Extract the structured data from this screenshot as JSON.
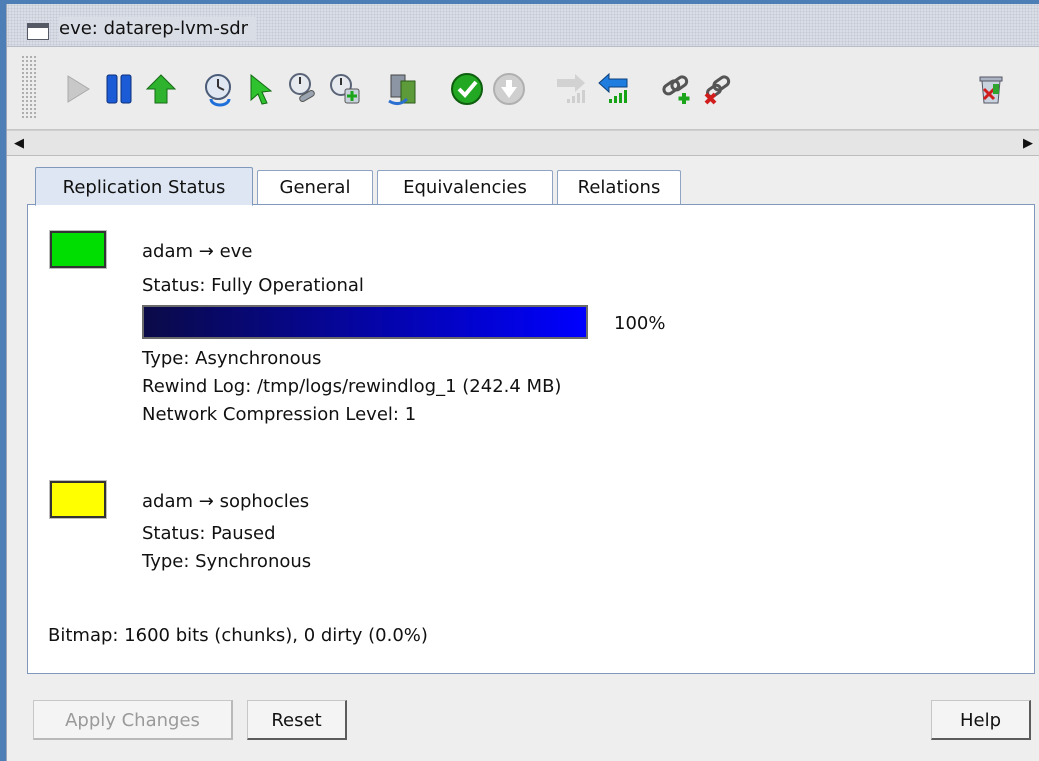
{
  "window": {
    "title": "eve: datarep-lvm-sdr"
  },
  "toolbar": {
    "buttons": [
      {
        "icon": "play-icon",
        "enabled": false
      },
      {
        "icon": "pause-icon",
        "enabled": true
      },
      {
        "icon": "up-arrow-icon",
        "enabled": true
      },
      {
        "icon": "clock-refresh-icon",
        "enabled": true
      },
      {
        "icon": "green-cursor-icon",
        "enabled": true
      },
      {
        "icon": "clock-wrench-icon",
        "enabled": true
      },
      {
        "icon": "clock-add-icon",
        "enabled": true
      },
      {
        "icon": "server-transfer-icon",
        "enabled": true
      },
      {
        "icon": "check-circle-icon",
        "enabled": true
      },
      {
        "icon": "down-circle-icon",
        "enabled": false
      },
      {
        "icon": "forward-signal-icon",
        "enabled": false
      },
      {
        "icon": "reverse-signal-icon",
        "enabled": true
      },
      {
        "icon": "link-add-icon",
        "enabled": true
      },
      {
        "icon": "link-remove-icon",
        "enabled": true
      },
      {
        "icon": "trash-icon",
        "enabled": true
      }
    ]
  },
  "tabs": [
    {
      "label": "Replication Status",
      "active": true
    },
    {
      "label": "General",
      "active": false
    },
    {
      "label": "Equivalencies",
      "active": false
    },
    {
      "label": "Relations",
      "active": false
    }
  ],
  "replications": [
    {
      "status_color": "#00dd00",
      "source": "adam",
      "arrow": "→",
      "target": "eve",
      "status": "Status: Fully Operational",
      "progress_fraction": 1.0,
      "progress_text": "100%",
      "type": "Type: Asynchronous",
      "rewind_log": "Rewind Log: /tmp/logs/rewindlog_1 (242.4 MB)",
      "compression": "Network Compression Level: 1"
    },
    {
      "status_color": "#ffff00",
      "source": "adam",
      "arrow": "→",
      "target": "sophocles",
      "status": "Status: Paused",
      "type": "Type: Synchronous"
    }
  ],
  "bitmap": "Bitmap: 1600 bits (chunks), 0 dirty (0.0%)",
  "buttons": {
    "apply": "Apply Changes",
    "reset": "Reset",
    "help": "Help"
  }
}
